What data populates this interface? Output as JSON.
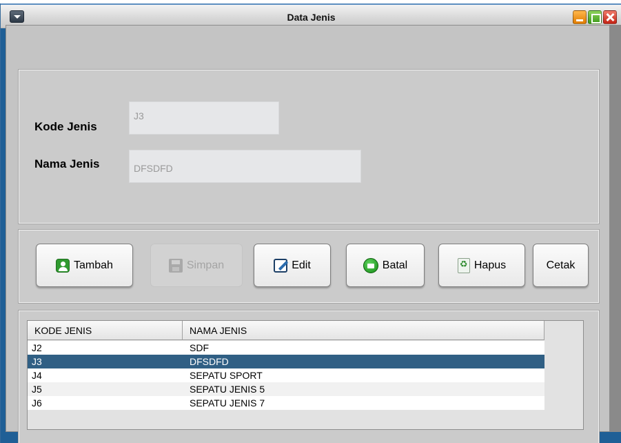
{
  "window": {
    "title": "Data Jenis"
  },
  "form": {
    "kode_label": "Kode Jenis",
    "kode_value": "J3",
    "nama_label": "Nama Jenis",
    "nama_value": "DFSDFD"
  },
  "buttons": {
    "tambah": "Tambah",
    "simpan": "Simpan",
    "edit": "Edit",
    "batal": "Batal",
    "hapus": "Hapus",
    "cetak": "Cetak"
  },
  "table": {
    "columns": [
      "KODE JENIS",
      "NAMA JENIS"
    ],
    "rows": [
      {
        "kode": "J2",
        "nama": "SDF"
      },
      {
        "kode": "J3",
        "nama": "DFSDFD"
      },
      {
        "kode": "J4",
        "nama": "SEPATU SPORT"
      },
      {
        "kode": "J5",
        "nama": "SEPATU JENIS 5"
      },
      {
        "kode": "J6",
        "nama": "SEPATU JENIS 7"
      }
    ],
    "selected_index": 1
  },
  "colors": {
    "selection": "#305f84",
    "window_frame": "#1f5f96",
    "panel": "#cbcbcb"
  },
  "icons": {
    "tambah": "add-user-icon",
    "simpan": "floppy-disk-icon",
    "edit": "pencil-edit-icon",
    "batal": "cancel-icon",
    "hapus": "recycle-bin-icon"
  }
}
